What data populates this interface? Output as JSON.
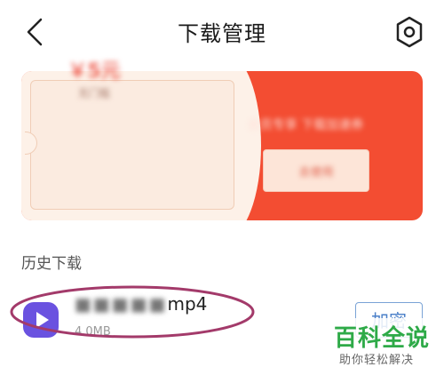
{
  "header": {
    "title": "下载管理"
  },
  "banner": {
    "amount": "￥5元",
    "condition": "无门槛",
    "description": "会员专享 下载加速券",
    "button_label": "去使用"
  },
  "history": {
    "section_title": "历史下载",
    "items": [
      {
        "filename_prefix": "■■■■■",
        "filename_suffix": "mp4",
        "size": "4.0MB",
        "action_label": "加密"
      }
    ]
  },
  "watermark": {
    "title": "百科全说",
    "subtitle": "助你轻松解决"
  },
  "colors": {
    "banner_red": "#f34d32",
    "coupon_cream": "#fdf1e8",
    "play_purple": "#6a52e0",
    "highlight_ring": "#a33a6a",
    "watermark_green": "#2eaa48",
    "button_blue": "#4a7fc8"
  },
  "icons": {
    "back": "back-arrow-icon",
    "settings": "hexagon-gear-icon",
    "file": "video-play-icon"
  }
}
